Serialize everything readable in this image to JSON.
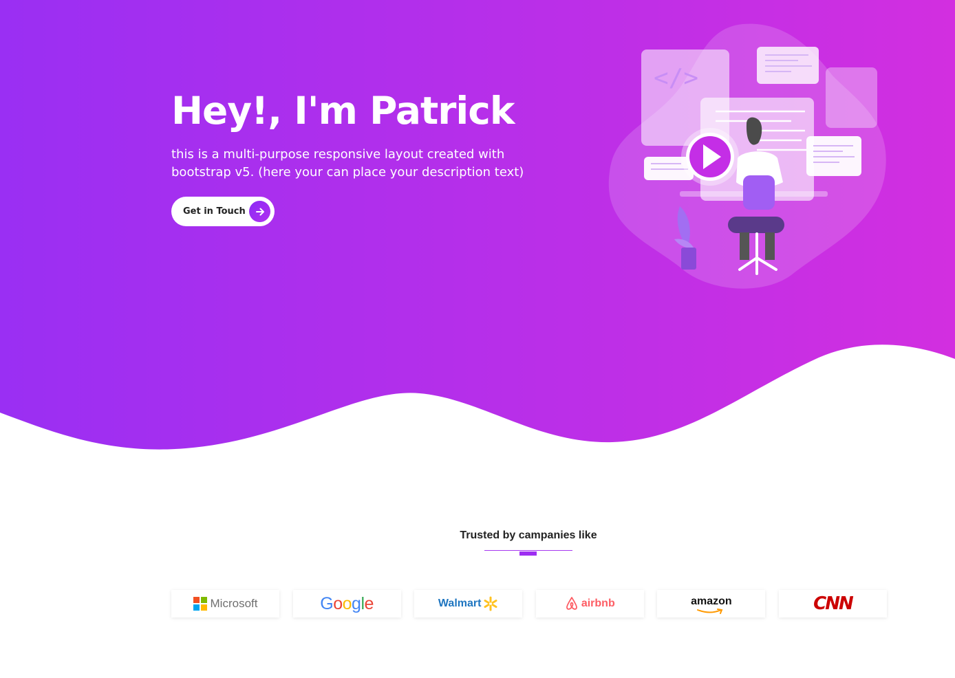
{
  "hero": {
    "title": "Hey!, I'm Patrick",
    "description": "this is a multi-purpose responsive layout created with bootstrap v5. (here your can place your description text)",
    "cta_label": "Get in Touch",
    "gradient_start": "#9a2ff3",
    "gradient_end": "#d22fe0"
  },
  "illustration": {
    "code_tag": "</>",
    "icons": [
      "play-icon",
      "code-icon"
    ]
  },
  "trusted": {
    "title": "Trusted by campanies like",
    "accent": "#9e2ef2"
  },
  "logos": [
    {
      "name": "Microsoft",
      "icon": "microsoft-logo"
    },
    {
      "name": "Google",
      "icon": "google-logo"
    },
    {
      "name": "Walmart",
      "icon": "walmart-logo"
    },
    {
      "name": "airbnb",
      "icon": "airbnb-logo"
    },
    {
      "name": "amazon",
      "icon": "amazon-logo"
    },
    {
      "name": "CNN",
      "icon": "cnn-logo"
    }
  ]
}
